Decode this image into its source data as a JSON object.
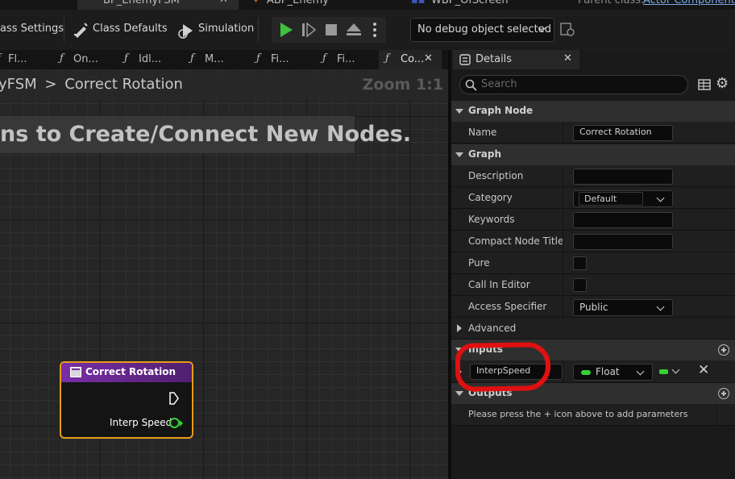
{
  "top_tabs": [
    {
      "label": "BP_EnemyFSM*"
    },
    {
      "label": "ABP_Enemy"
    },
    {
      "label": "WBP_OfScreen"
    }
  ],
  "parent_class": {
    "label": "Parent class:",
    "value": "Actor Component"
  },
  "toolbar": {
    "class_settings": "ass Settings",
    "class_defaults": "Class Defaults",
    "simulation": "Simulation",
    "debug_select": "No debug object selected"
  },
  "graph_tabs": [
    {
      "label": "Fl..."
    },
    {
      "label": "On..."
    },
    {
      "label": "Idl..."
    },
    {
      "label": "M..."
    },
    {
      "label": "Fi..."
    },
    {
      "label": "Fi..."
    },
    {
      "label": "Co..."
    }
  ],
  "graph": {
    "breadcrumb_parent": "yFSM",
    "breadcrumb_sep": ">",
    "breadcrumb_current": "Correct Rotation",
    "zoom": "Zoom 1:1",
    "hint": "ns to Create/Connect New Nodes."
  },
  "node": {
    "title": "Correct Rotation",
    "pin_label": "Interp Speed"
  },
  "details": {
    "tab_label": "Details",
    "search_placeholder": "Search",
    "sections": {
      "graph_node": "Graph Node",
      "graph": "Graph",
      "advanced": "Advanced",
      "inputs": "Inputs",
      "outputs": "Outputs"
    },
    "rows": {
      "name": {
        "label": "Name",
        "value": "Correct Rotation"
      },
      "description": {
        "label": "Description",
        "value": ""
      },
      "category": {
        "label": "Category",
        "value": "Default"
      },
      "keywords": {
        "label": "Keywords",
        "value": ""
      },
      "compact_title": {
        "label": "Compact Node Title",
        "value": ""
      },
      "pure": {
        "label": "Pure"
      },
      "call_in_editor": {
        "label": "Call In Editor"
      },
      "access_specifier": {
        "label": "Access Specifier",
        "value": "Public"
      }
    },
    "input_param": {
      "name": "InterpSpeed",
      "type": "Float"
    },
    "outputs_hint": "Please press the + icon above to add parameters"
  },
  "colors": {
    "accent_node_border": "#e59c17",
    "node_header": "#7a2ea8",
    "float_pin": "#35d135",
    "annotation": "#e01010",
    "play_green": "#3fc13f"
  }
}
